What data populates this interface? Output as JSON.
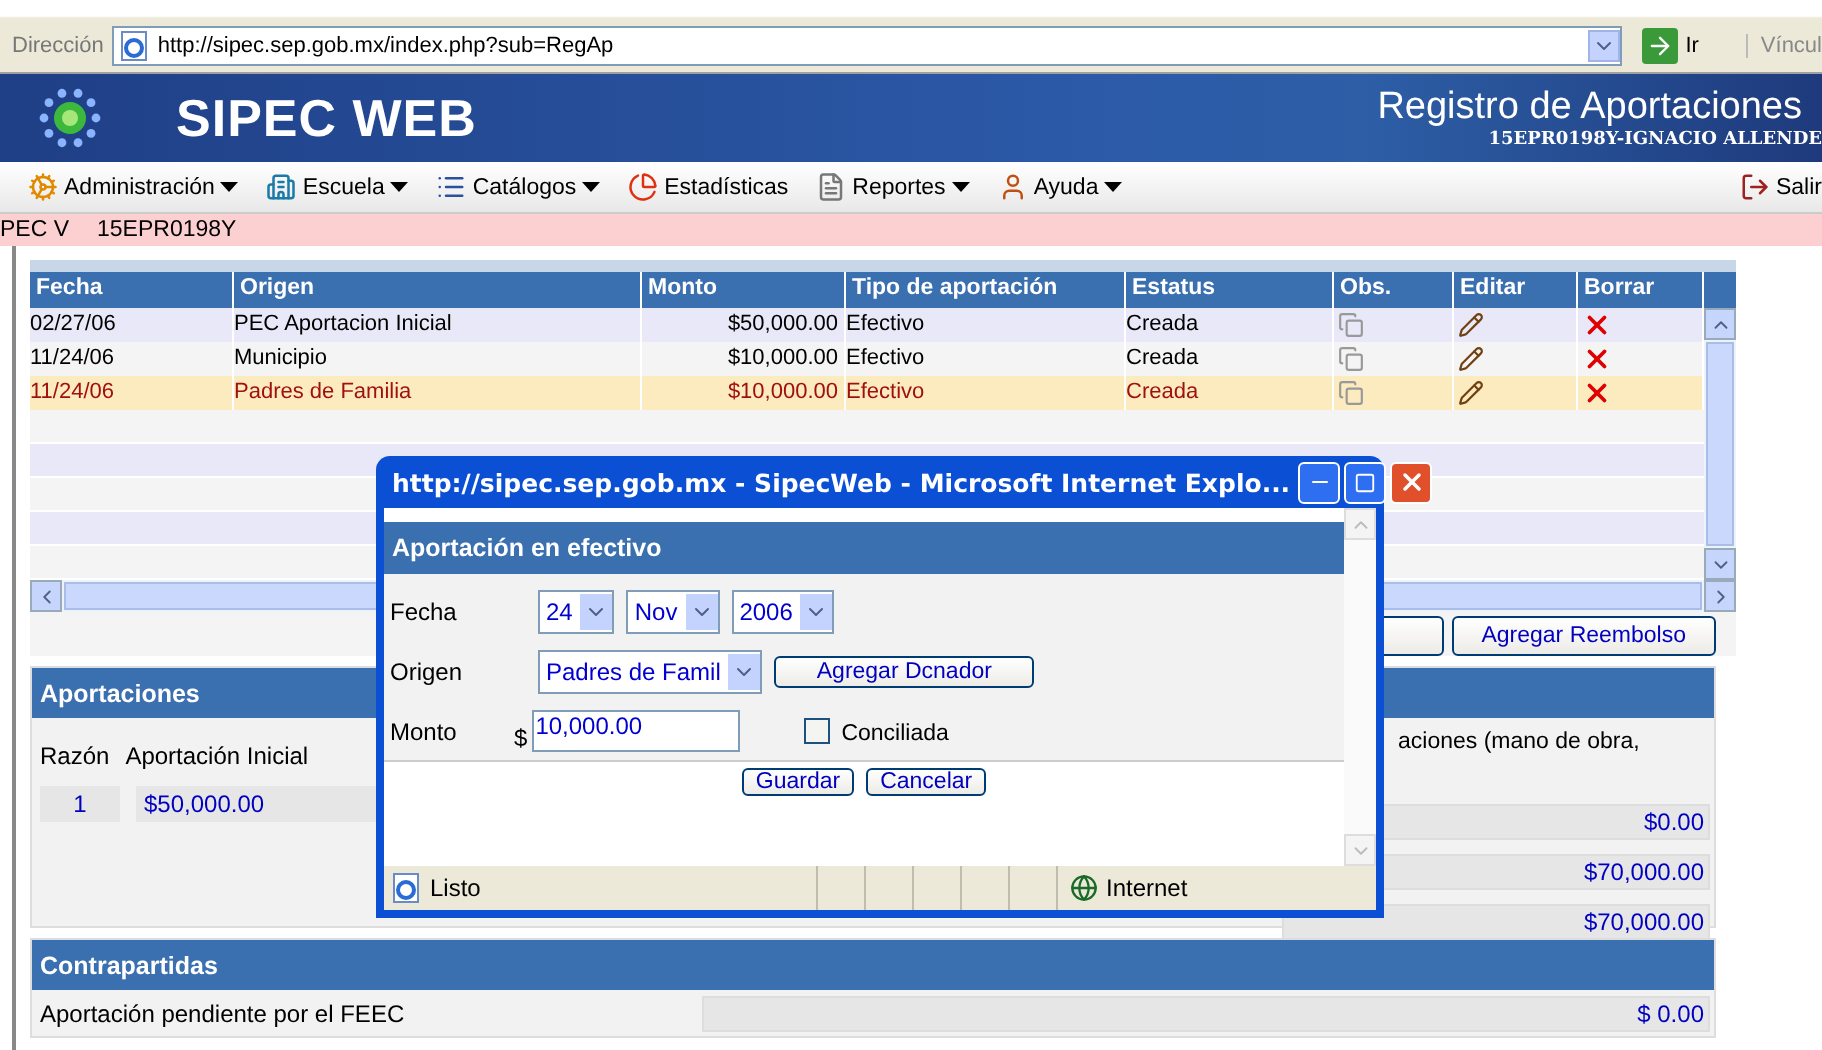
{
  "address_bar": {
    "label": "Dirección",
    "url": "http://sipec.sep.gob.mx/index.php?sub=RegAp",
    "go": "Ir",
    "links": "Víncul"
  },
  "header": {
    "title": "SIPEC WEB",
    "page_title": "Registro de Aportaciones",
    "school": "15EPR0198Y-IGNACIO ALLENDE"
  },
  "menu": [
    {
      "label": "Administración",
      "dropdown": true
    },
    {
      "label": "Escuela",
      "dropdown": true
    },
    {
      "label": "Catálogos",
      "dropdown": true
    },
    {
      "label": "Estadísticas",
      "dropdown": false
    },
    {
      "label": "Reportes",
      "dropdown": true
    },
    {
      "label": "Ayuda",
      "dropdown": true
    }
  ],
  "logout": "Salir",
  "program_bar": [
    "PEC V",
    "15EPR0198Y"
  ],
  "table": {
    "columns": [
      "Fecha",
      "Origen",
      "Monto",
      "Tipo de aportación",
      "Estatus",
      "Obs.",
      "Editar",
      "Borrar"
    ],
    "rows": [
      {
        "cells": [
          "02/27/06",
          "PEC Aportacion Inicial",
          "$50,000.00",
          "Efectivo",
          "Creada"
        ],
        "selected": false
      },
      {
        "cells": [
          "11/24/06",
          "Municipio",
          "$10,000.00",
          "Efectivo",
          "Creada"
        ],
        "selected": false
      },
      {
        "cells": [
          "11/24/06",
          "Padres de Familia",
          "$10,000.00",
          "Efectivo",
          "Creada"
        ],
        "selected": true
      }
    ]
  },
  "action_buttons": [
    "Agregar Reembolso"
  ],
  "aportaciones": {
    "title": "Aportaciones",
    "columns": [
      "Razón",
      "Aportación Inicial"
    ],
    "row": [
      "1",
      "$50,000.00"
    ],
    "right_label": "aciones (mano de obra,",
    "totals": [
      "$0.00",
      "$70,000.00",
      "$70,000.00"
    ]
  },
  "contrapartidas": {
    "title": "Contrapartidas",
    "label": "Aportación pendiente por el FEEC",
    "value": "$ 0.00"
  },
  "popup": {
    "title": "http://sipec.sep.gob.mx - SipecWeb - Microsoft Internet Explo...",
    "heading": "Aportación en efectivo",
    "fecha": {
      "label": "Fecha",
      "day": "24",
      "month": "Nov",
      "year": "2006"
    },
    "origen": {
      "label": "Origen",
      "value": "Padres de Famil",
      "button": "Agregar Dcnador"
    },
    "monto": {
      "label": "Monto",
      "currency": "$",
      "value": "10,000.00"
    },
    "conciliada": {
      "label": "Conciliada",
      "checked": false
    },
    "buttons": [
      "Guardar",
      "Cancelar"
    ],
    "status": "Listo",
    "zone": "Internet"
  }
}
